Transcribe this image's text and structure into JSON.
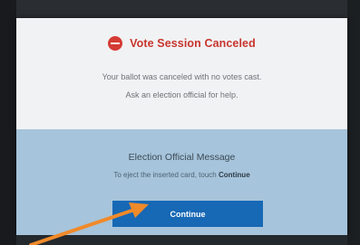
{
  "dialog": {
    "title": "Vote Session Canceled",
    "message_line1": "Your ballot was canceled with no votes cast.",
    "message_line2": "Ask an election official for help."
  },
  "official_message": {
    "title": "Election Official Message",
    "instruction_prefix": "To eject the inserted card, touch",
    "instruction_emphasis": "Continue"
  },
  "actions": {
    "continue_label": "Continue"
  },
  "icons": {
    "status": "cancel-icon",
    "annotation": "orange-arrow"
  },
  "colors": {
    "title_red": "#c8342e",
    "button_blue": "#1768b5",
    "panel_blue": "#a6c4db",
    "arrow_orange": "#f08a2a"
  }
}
